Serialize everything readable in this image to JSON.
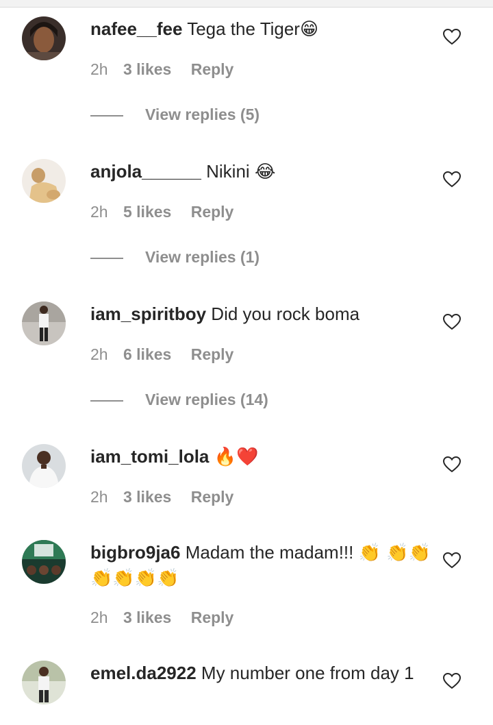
{
  "comments": [
    {
      "username": "nafee__fee",
      "text": "Tega the Tiger",
      "emoji": "😁",
      "time": "2h",
      "likes": "3 likes",
      "reply": "Reply",
      "view_replies": "View replies (5)"
    },
    {
      "username": "anjola______",
      "text": "Nikini",
      "emoji": "😂",
      "time": "2h",
      "likes": "5 likes",
      "reply": "Reply",
      "view_replies": "View replies (1)"
    },
    {
      "username": "iam_spiritboy",
      "text": "Did you rock boma",
      "emoji": "",
      "time": "2h",
      "likes": "6 likes",
      "reply": "Reply",
      "view_replies": "View replies (14)"
    },
    {
      "username": "iam_tomi_lola",
      "text": "",
      "emoji": "🔥❤️",
      "time": "2h",
      "likes": "3 likes",
      "reply": "Reply",
      "view_replies": ""
    },
    {
      "username": "bigbro9ja6",
      "text": "Madam the madam!!!",
      "emoji": "👏 👏👏👏👏👏👏",
      "time": "2h",
      "likes": "3 likes",
      "reply": "Reply",
      "view_replies": ""
    },
    {
      "username": "emel.da2922",
      "text": "My number one from day 1",
      "emoji": "",
      "time": "",
      "likes": "",
      "reply": "",
      "view_replies": ""
    }
  ],
  "icons": {
    "like": "heart-outline-icon",
    "avatar": "profile-photo"
  },
  "colors": {
    "text": "#262626",
    "secondary": "#8e8e8e",
    "background": "#ffffff"
  }
}
